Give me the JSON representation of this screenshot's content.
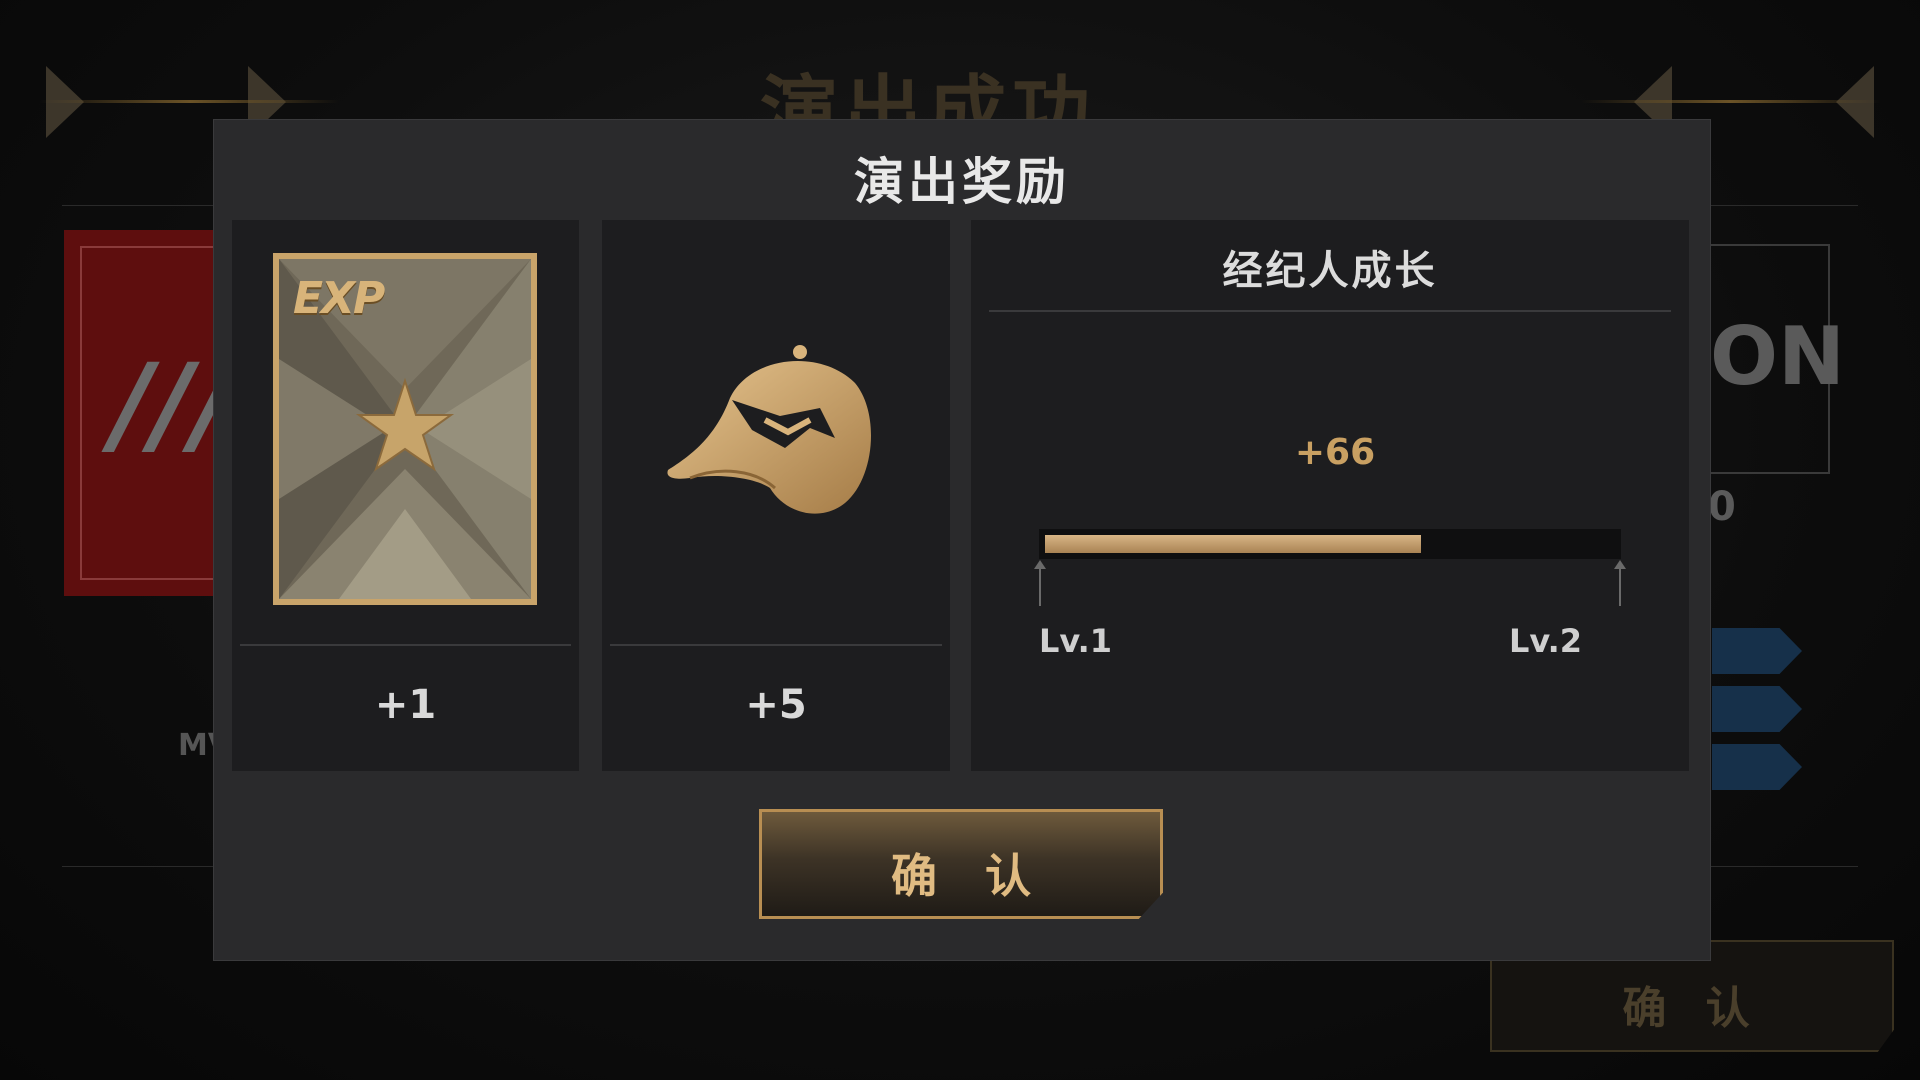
{
  "background": {
    "title": "演出成功",
    "left_label": "MV",
    "right_text": "ON",
    "right_number": "0",
    "confirm_label": "确 认"
  },
  "modal": {
    "title": "演出奖励",
    "rewards": [
      {
        "icon": "exp-card-icon",
        "card_label": "EXP",
        "amount": "+1"
      },
      {
        "icon": "baseball-cap-icon",
        "amount": "+5"
      }
    ],
    "growth": {
      "title": "经纪人成长",
      "gain": "+66",
      "progress": 0.66,
      "level_from": "Lv.1",
      "level_to": "Lv.2"
    },
    "confirm_label": "确 认"
  },
  "colors": {
    "gold": "#c9a062",
    "panel": "#1d1d1f",
    "modal": "#2a2a2c"
  }
}
